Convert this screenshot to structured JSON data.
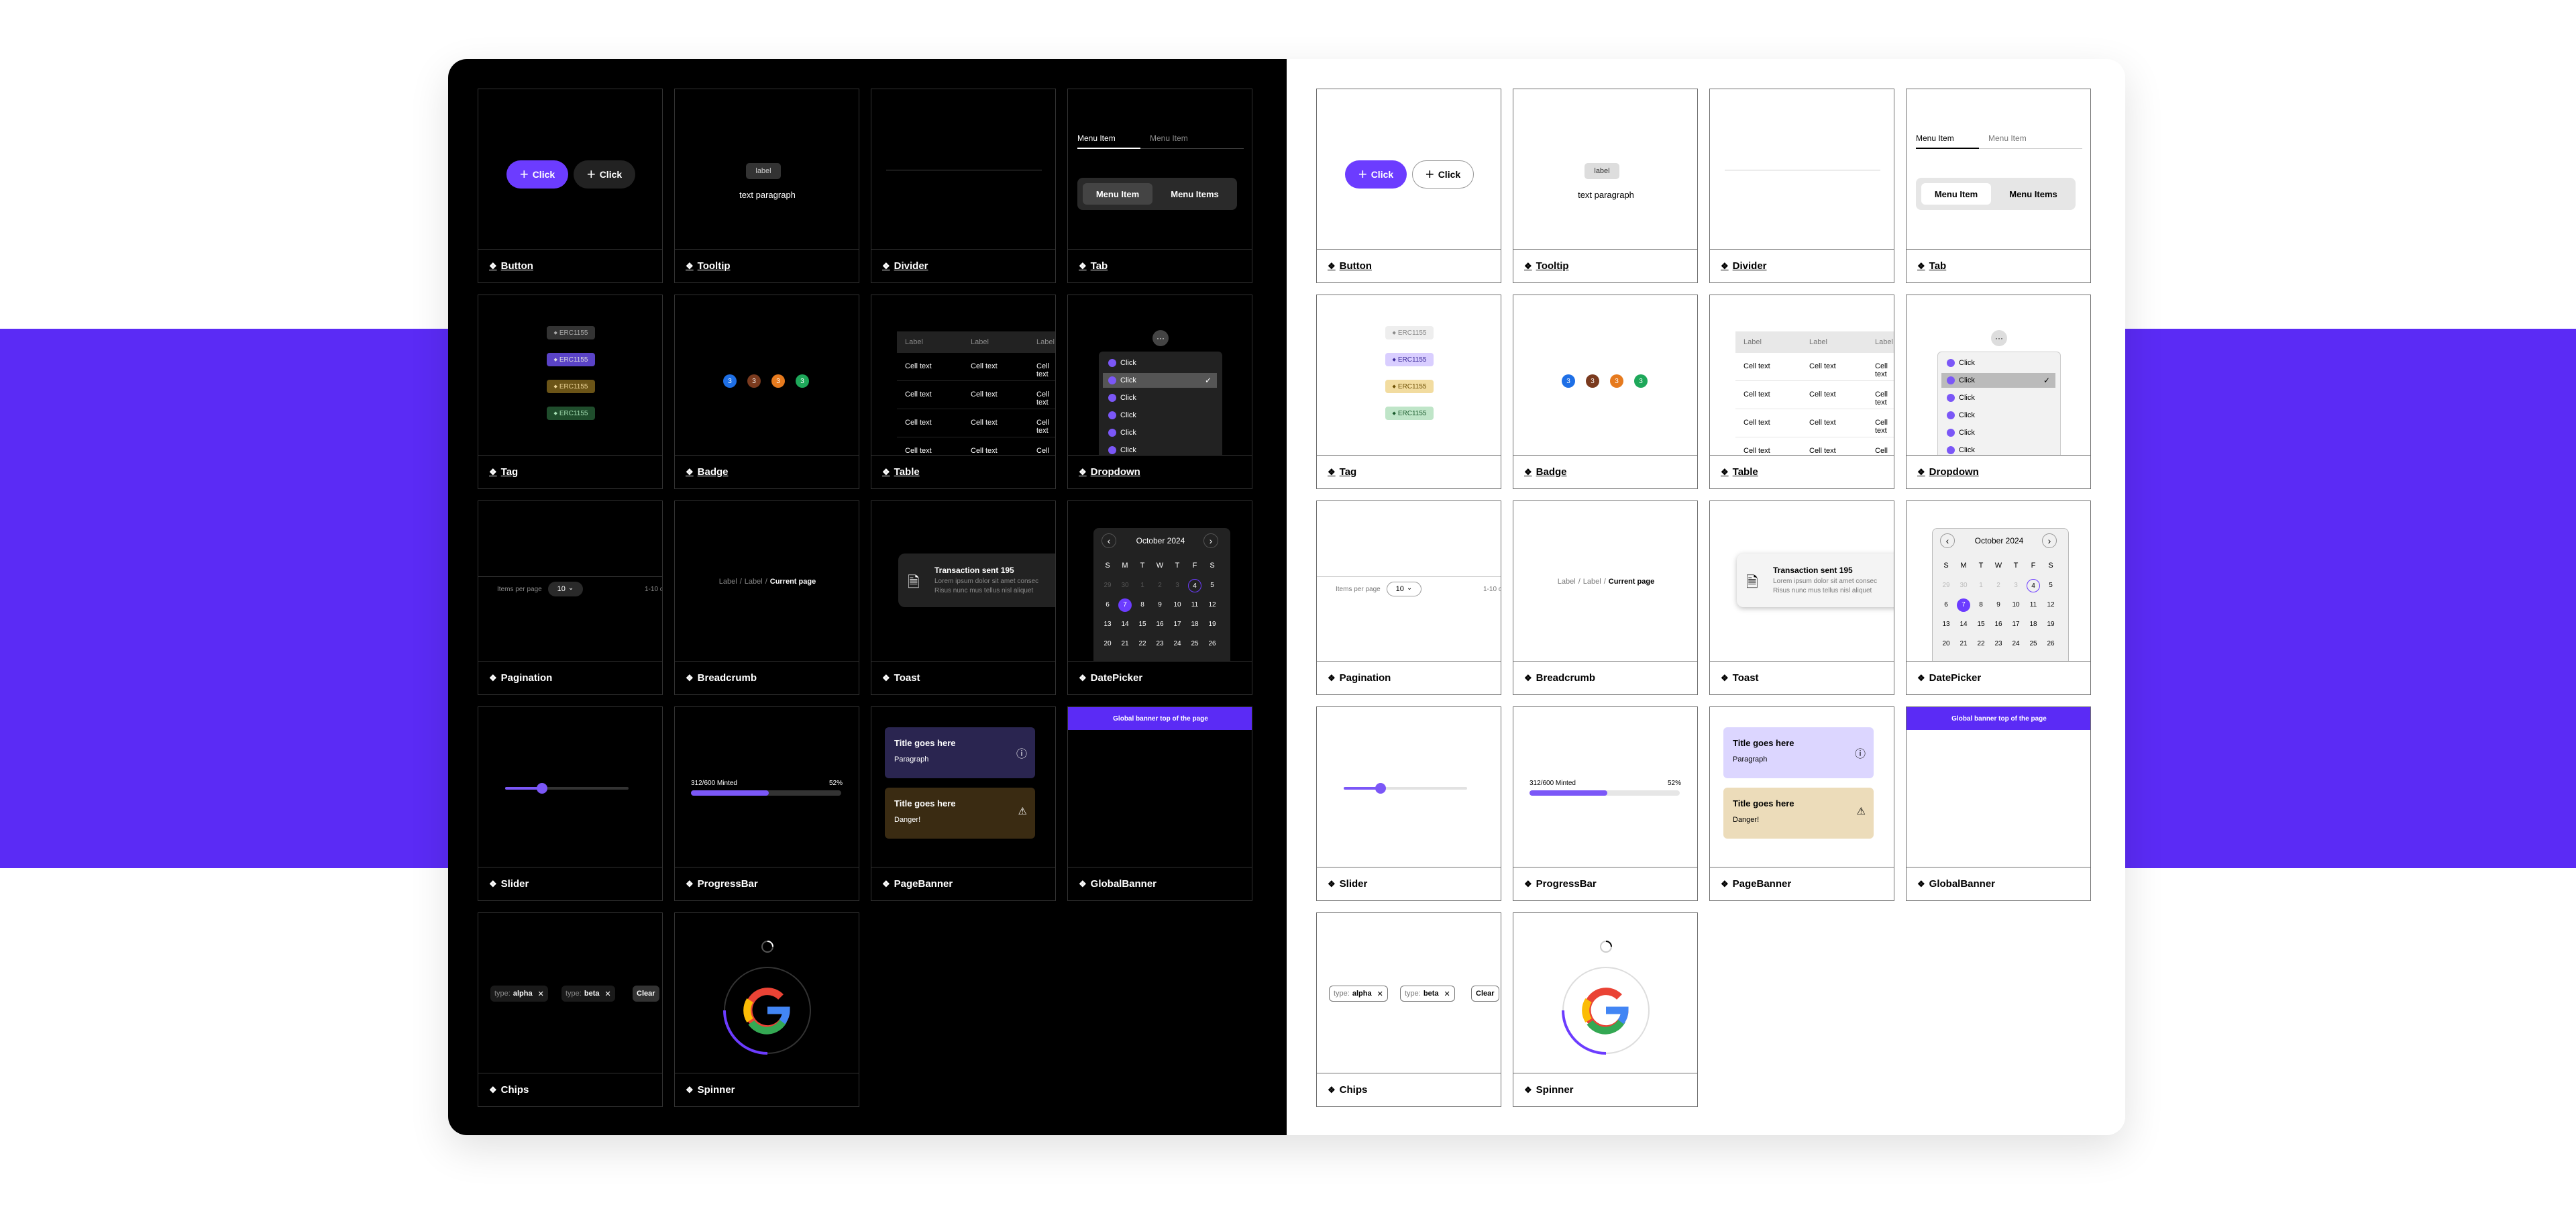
{
  "labels": {
    "button": "Button",
    "tooltip": "Tooltip",
    "divider": "Divider",
    "tab": "Tab",
    "tag": "Tag",
    "badge": "Badge",
    "table": "Table",
    "dropdown": "Dropdown",
    "pagination": "Pagination",
    "breadcrumb": "Breadcrumb",
    "toast": "Toast",
    "datepicker": "DatePicker",
    "slider": "Slider",
    "progressbar": "ProgressBar",
    "pagebanner": "PageBanner",
    "globalbanner": "GlobalBanner",
    "chips": "Chips",
    "spinner": "Spinner"
  },
  "button": {
    "label": "Click"
  },
  "tooltip": {
    "label": "label",
    "text": "text paragraph"
  },
  "tab": {
    "item1": "Menu Item",
    "item2": "Menu Item",
    "seg1": "Menu Item",
    "seg2": "Menu Items"
  },
  "tag": {
    "label": "ERC1155"
  },
  "badge": {
    "numbers": [
      "3",
      "3",
      "3",
      "3"
    ]
  },
  "table": {
    "header": "Label",
    "cell": "Cell text"
  },
  "dropdown": {
    "item": "Click"
  },
  "pagination": {
    "label": "Items per page",
    "value": "10",
    "range": "1-10 o"
  },
  "breadcrumb": {
    "crumb1": "Label",
    "crumb2": "Label",
    "current": "Current page",
    "sep": "/"
  },
  "toast": {
    "title": "Transaction sent 195",
    "line1": "Lorem ipsum dolor sit amet consec",
    "line2": "Risus nunc mus tellus nisl aliquet"
  },
  "datepicker": {
    "month": "October 2024",
    "weekdays": [
      "S",
      "M",
      "T",
      "W",
      "T",
      "F",
      "S"
    ],
    "rows": [
      [
        "29",
        "30",
        "1",
        "2",
        "3",
        "4",
        "5"
      ],
      [
        "6",
        "7",
        "8",
        "9",
        "10",
        "11",
        "12"
      ],
      [
        "13",
        "14",
        "15",
        "16",
        "17",
        "18",
        "19"
      ],
      [
        "20",
        "21",
        "22",
        "23",
        "24",
        "25",
        "26"
      ]
    ]
  },
  "progress": {
    "label": "312/600 Minted",
    "percent": "52%",
    "value": 0.52
  },
  "slider": {
    "value": 0.3
  },
  "pagebanner": {
    "title1": "Title goes here",
    "text1": "Paragraph",
    "title2": "Title goes here",
    "text2": "Danger!"
  },
  "globalbanner": {
    "text": "Global banner top of the page"
  },
  "chips": {
    "key1": "type:",
    "val1": "alpha",
    "key2": "type:",
    "val2": "beta",
    "clear": "Clear"
  },
  "colors": {
    "accent": "#5b2bf5",
    "band": "#5b2bf5"
  }
}
